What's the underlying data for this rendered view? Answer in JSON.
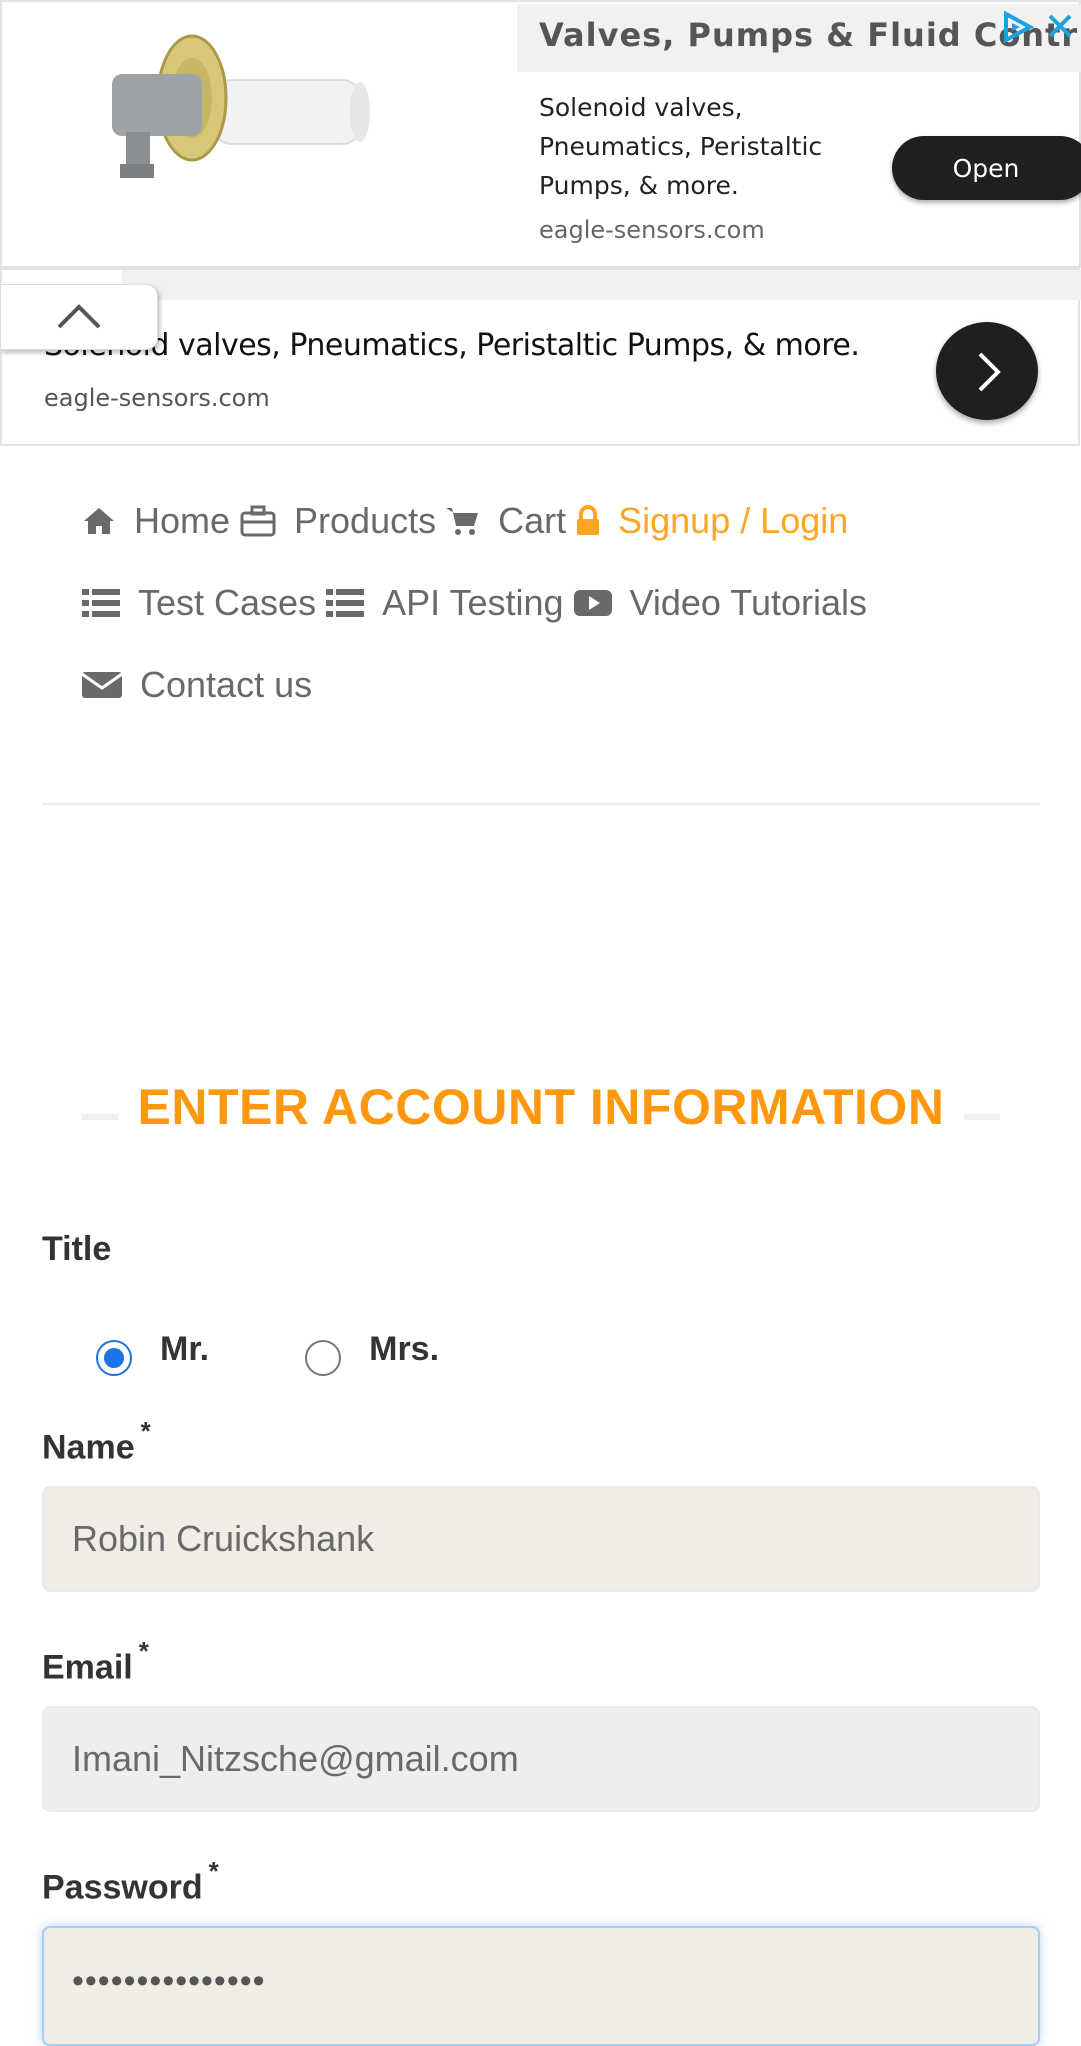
{
  "ad_top": {
    "title": "Valves, Pumps & Fluid Controls",
    "description": "Solenoid valves, Pneumatics, Peristaltic Pumps, & more.",
    "domain": "eagle-sensors.com",
    "open_label": "Open",
    "adchoices_icon": "adchoices-icon",
    "close_icon": "close-icon"
  },
  "ad_bottom": {
    "description": "Solenoid valves, Pneumatics, Peristaltic Pumps, & more.",
    "domain": "eagle-sensors.com",
    "arrow_icon": "chevron-right-icon"
  },
  "collapse_icon": "chevron-up-icon",
  "nav": {
    "home": "Home",
    "products": "Products",
    "cart": "Cart",
    "signup_login": "Signup / Login",
    "test_cases": "Test Cases",
    "api_testing": "API Testing",
    "video_tutorials": "Video Tutorials",
    "contact_us": "Contact us",
    "active_color": "#fea623"
  },
  "form": {
    "section_title": "ENTER ACCOUNT INFORMATION",
    "title_label": "Title",
    "title_options": [
      "Mr.",
      "Mrs."
    ],
    "title_selected": "Mr.",
    "name_label": "Name",
    "name_value": "Robin Cruickshank",
    "email_label": "Email",
    "email_value": "Imani_Nitzsche@gmail.com",
    "password_label": "Password",
    "password_value": "•••••••••••••••",
    "required_mark": "*",
    "accent_color": "#fe980f"
  }
}
